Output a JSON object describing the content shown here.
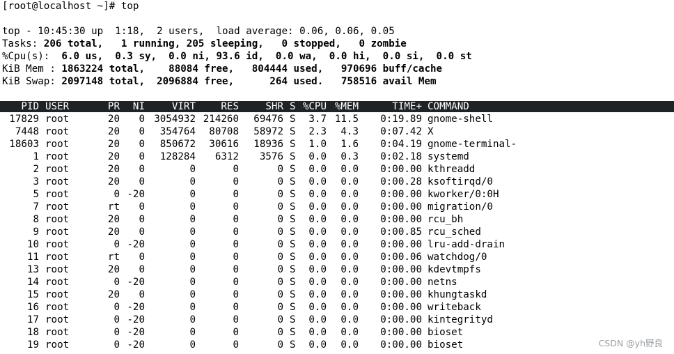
{
  "prompt": "[root@localhost ~]# top",
  "summary": {
    "line1": "top - 10:45:30 up  1:18,  2 users,  load average: 0.06, 0.06, 0.05",
    "line2_label": "Tasks:",
    "line2_rest": " 206 total,   1 running, 205 sleeping,   0 stopped,   0 zombie",
    "line3_label": "%Cpu(s):",
    "line3_rest": "  6.0 us,  0.3 sy,  0.0 ni, 93.6 id,  0.0 wa,  0.0 hi,  0.0 si,  0.0 st",
    "line4_label": "KiB Mem :",
    "line4_rest": " 1863224 total,    88084 free,   804444 used,   970696 buff/cache",
    "line5_label": "KiB Swap:",
    "line5_rest": " 2097148 total,  2096884 free,      264 used.   758516 avail Mem"
  },
  "columns": {
    "pid": "PID",
    "user": "USER",
    "pr": "PR",
    "ni": "NI",
    "virt": "VIRT",
    "res": "RES",
    "shr": "SHR",
    "s": "S",
    "cpu": "%CPU",
    "mem": "%MEM",
    "time": "TIME+",
    "command": "COMMAND"
  },
  "processes": [
    {
      "pid": "17829",
      "user": "root",
      "pr": "20",
      "ni": "0",
      "virt": "3054932",
      "res": "214260",
      "shr": "69476",
      "s": "S",
      "cpu": "3.7",
      "mem": "11.5",
      "time": "0:19.89",
      "command": "gnome-shell"
    },
    {
      "pid": "7448",
      "user": "root",
      "pr": "20",
      "ni": "0",
      "virt": "354764",
      "res": "80708",
      "shr": "58972",
      "s": "S",
      "cpu": "2.3",
      "mem": "4.3",
      "time": "0:07.42",
      "command": "X"
    },
    {
      "pid": "18603",
      "user": "root",
      "pr": "20",
      "ni": "0",
      "virt": "850672",
      "res": "30616",
      "shr": "18936",
      "s": "S",
      "cpu": "1.0",
      "mem": "1.6",
      "time": "0:04.19",
      "command": "gnome-terminal-"
    },
    {
      "pid": "1",
      "user": "root",
      "pr": "20",
      "ni": "0",
      "virt": "128284",
      "res": "6312",
      "shr": "3576",
      "s": "S",
      "cpu": "0.0",
      "mem": "0.3",
      "time": "0:02.18",
      "command": "systemd"
    },
    {
      "pid": "2",
      "user": "root",
      "pr": "20",
      "ni": "0",
      "virt": "0",
      "res": "0",
      "shr": "0",
      "s": "S",
      "cpu": "0.0",
      "mem": "0.0",
      "time": "0:00.00",
      "command": "kthreadd"
    },
    {
      "pid": "3",
      "user": "root",
      "pr": "20",
      "ni": "0",
      "virt": "0",
      "res": "0",
      "shr": "0",
      "s": "S",
      "cpu": "0.0",
      "mem": "0.0",
      "time": "0:00.28",
      "command": "ksoftirqd/0"
    },
    {
      "pid": "5",
      "user": "root",
      "pr": "0",
      "ni": "-20",
      "virt": "0",
      "res": "0",
      "shr": "0",
      "s": "S",
      "cpu": "0.0",
      "mem": "0.0",
      "time": "0:00.00",
      "command": "kworker/0:0H"
    },
    {
      "pid": "7",
      "user": "root",
      "pr": "rt",
      "ni": "0",
      "virt": "0",
      "res": "0",
      "shr": "0",
      "s": "S",
      "cpu": "0.0",
      "mem": "0.0",
      "time": "0:00.00",
      "command": "migration/0"
    },
    {
      "pid": "8",
      "user": "root",
      "pr": "20",
      "ni": "0",
      "virt": "0",
      "res": "0",
      "shr": "0",
      "s": "S",
      "cpu": "0.0",
      "mem": "0.0",
      "time": "0:00.00",
      "command": "rcu_bh"
    },
    {
      "pid": "9",
      "user": "root",
      "pr": "20",
      "ni": "0",
      "virt": "0",
      "res": "0",
      "shr": "0",
      "s": "S",
      "cpu": "0.0",
      "mem": "0.0",
      "time": "0:00.85",
      "command": "rcu_sched"
    },
    {
      "pid": "10",
      "user": "root",
      "pr": "0",
      "ni": "-20",
      "virt": "0",
      "res": "0",
      "shr": "0",
      "s": "S",
      "cpu": "0.0",
      "mem": "0.0",
      "time": "0:00.00",
      "command": "lru-add-drain"
    },
    {
      "pid": "11",
      "user": "root",
      "pr": "rt",
      "ni": "0",
      "virt": "0",
      "res": "0",
      "shr": "0",
      "s": "S",
      "cpu": "0.0",
      "mem": "0.0",
      "time": "0:00.06",
      "command": "watchdog/0"
    },
    {
      "pid": "13",
      "user": "root",
      "pr": "20",
      "ni": "0",
      "virt": "0",
      "res": "0",
      "shr": "0",
      "s": "S",
      "cpu": "0.0",
      "mem": "0.0",
      "time": "0:00.00",
      "command": "kdevtmpfs"
    },
    {
      "pid": "14",
      "user": "root",
      "pr": "0",
      "ni": "-20",
      "virt": "0",
      "res": "0",
      "shr": "0",
      "s": "S",
      "cpu": "0.0",
      "mem": "0.0",
      "time": "0:00.00",
      "command": "netns"
    },
    {
      "pid": "15",
      "user": "root",
      "pr": "20",
      "ni": "0",
      "virt": "0",
      "res": "0",
      "shr": "0",
      "s": "S",
      "cpu": "0.0",
      "mem": "0.0",
      "time": "0:00.00",
      "command": "khungtaskd"
    },
    {
      "pid": "16",
      "user": "root",
      "pr": "0",
      "ni": "-20",
      "virt": "0",
      "res": "0",
      "shr": "0",
      "s": "S",
      "cpu": "0.0",
      "mem": "0.0",
      "time": "0:00.00",
      "command": "writeback"
    },
    {
      "pid": "17",
      "user": "root",
      "pr": "0",
      "ni": "-20",
      "virt": "0",
      "res": "0",
      "shr": "0",
      "s": "S",
      "cpu": "0.0",
      "mem": "0.0",
      "time": "0:00.00",
      "command": "kintegrityd"
    },
    {
      "pid": "18",
      "user": "root",
      "pr": "0",
      "ni": "-20",
      "virt": "0",
      "res": "0",
      "shr": "0",
      "s": "S",
      "cpu": "0.0",
      "mem": "0.0",
      "time": "0:00.00",
      "command": "bioset"
    },
    {
      "pid": "19",
      "user": "root",
      "pr": "0",
      "ni": "-20",
      "virt": "0",
      "res": "0",
      "shr": "0",
      "s": "S",
      "cpu": "0.0",
      "mem": "0.0",
      "time": "0:00.00",
      "command": "bioset"
    }
  ],
  "watermark": "CSDN @yh野良",
  "colors": {
    "background": "#ffffff",
    "text": "#000000",
    "header_bar": "#1f2326",
    "header_text": "#ffffff"
  }
}
